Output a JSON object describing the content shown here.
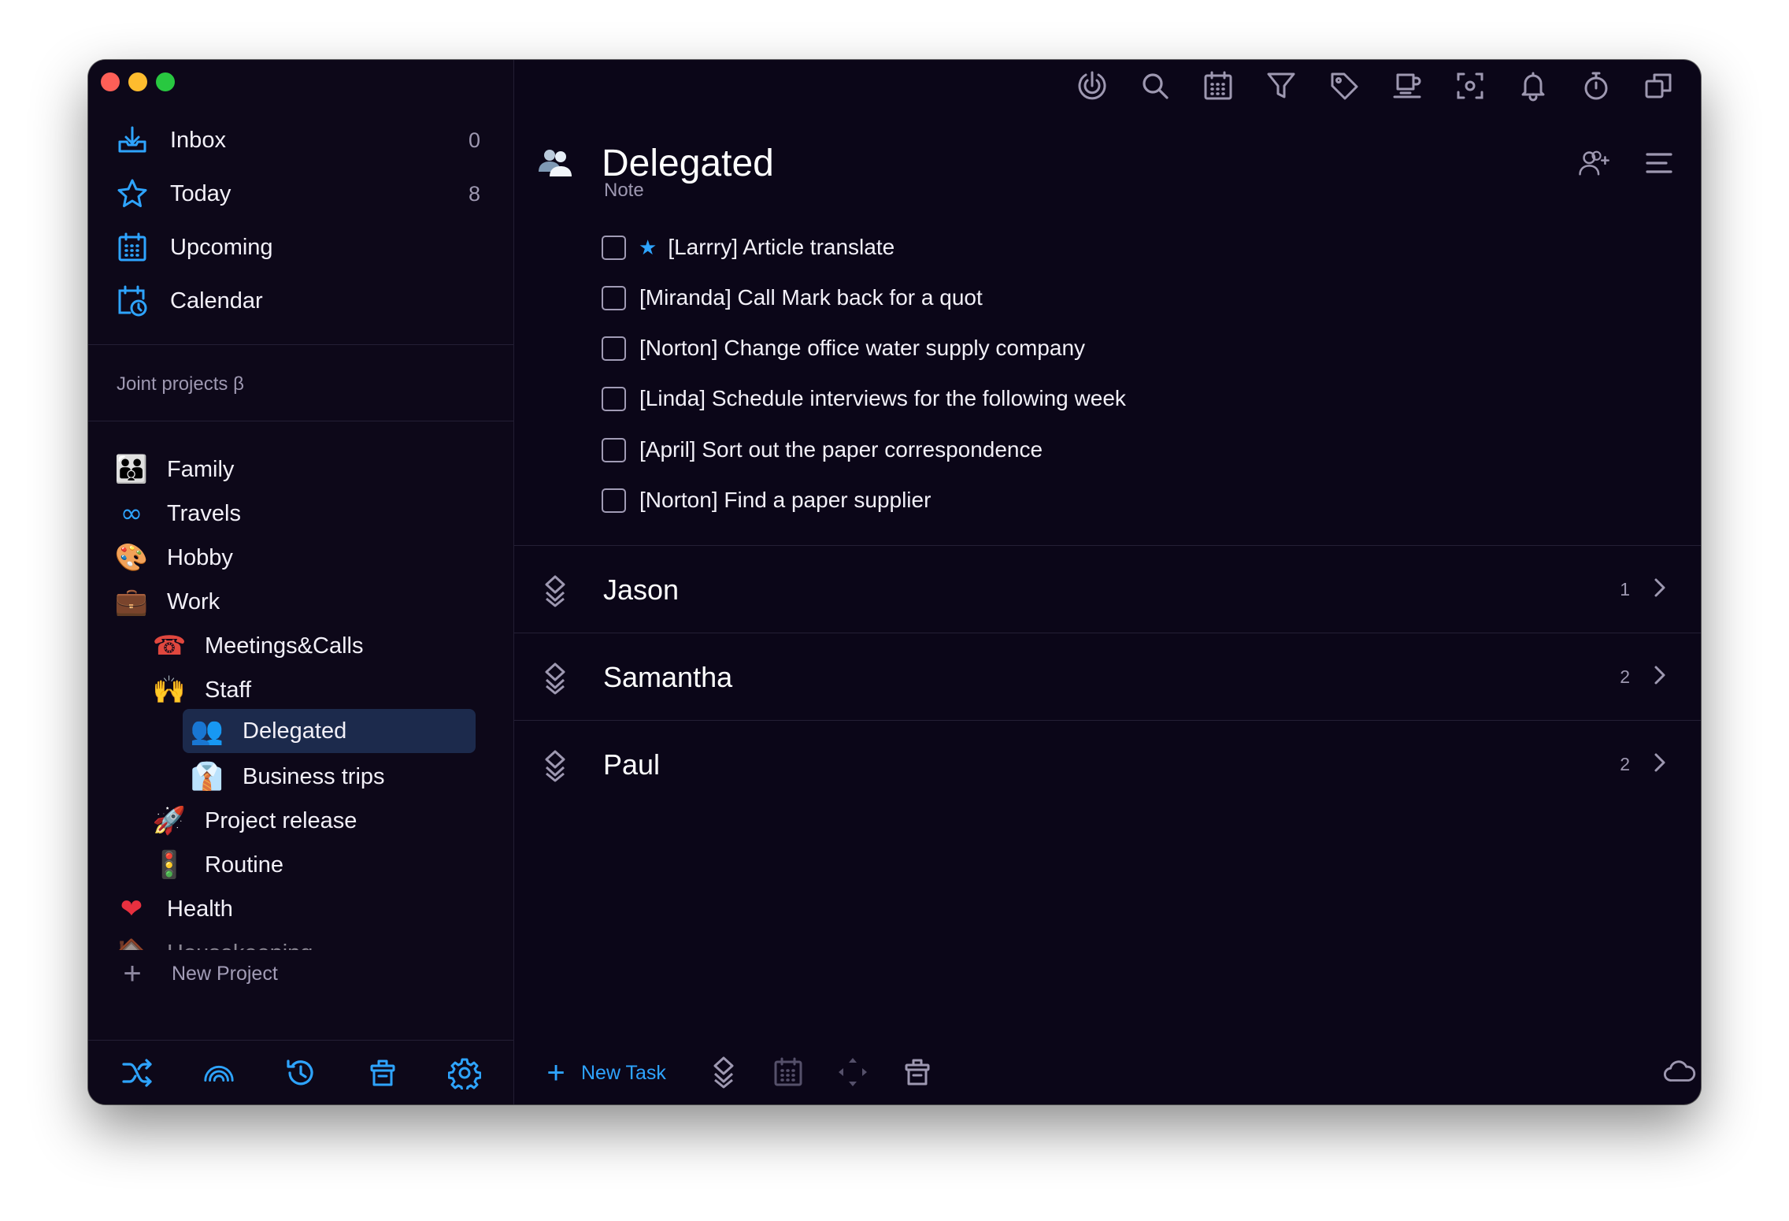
{
  "sidebar": {
    "nav": [
      {
        "label": "Inbox",
        "count": "0",
        "icon": "inbox-tray-icon"
      },
      {
        "label": "Today",
        "count": "8",
        "icon": "star-icon"
      },
      {
        "label": "Upcoming",
        "count": "",
        "icon": "calendar-grid-icon"
      },
      {
        "label": "Calendar",
        "count": "",
        "icon": "calendar-clock-icon"
      }
    ],
    "section_title": "Joint projects β",
    "projects": [
      {
        "label": "Family",
        "emoji": "👪"
      },
      {
        "label": "Travels",
        "emoji": "∞"
      },
      {
        "label": "Hobby",
        "emoji": "🎨"
      },
      {
        "label": "Work",
        "emoji": "💼"
      },
      {
        "label": "Meetings&Calls",
        "emoji": "☎"
      },
      {
        "label": "Staff",
        "emoji": "🙌"
      },
      {
        "label": "Delegated",
        "emoji": "👥"
      },
      {
        "label": "Business trips",
        "emoji": "👔"
      },
      {
        "label": "Project release",
        "emoji": "🚀"
      },
      {
        "label": "Routine",
        "emoji": "🚦"
      },
      {
        "label": "Health",
        "emoji": "❤"
      },
      {
        "label": "Housekeeping",
        "emoji": "🏠"
      }
    ],
    "new_project": "New Project"
  },
  "main": {
    "title": "Delegated",
    "note": "Note",
    "tasks": [
      {
        "text": "[Larrry] Article translate",
        "starred": true
      },
      {
        "text": "[Miranda] Call Mark back for a quot",
        "starred": false
      },
      {
        "text": "[Norton] Change office water supply company",
        "starred": false
      },
      {
        "text": "[Linda] Schedule interviews for the following week",
        "starred": false
      },
      {
        "text": "[April] Sort out the paper correspondence",
        "starred": false
      },
      {
        "text": "[Norton] Find a paper supplier",
        "starred": false
      }
    ],
    "groups": [
      {
        "name": "Jason",
        "count": "1"
      },
      {
        "name": "Samantha",
        "count": "2"
      },
      {
        "name": "Paul",
        "count": "2"
      }
    ],
    "new_task": "New Task"
  },
  "colors": {
    "accent": "#2ea4ff",
    "background": "#0b0618",
    "selected": "#1c2a4c",
    "muted": "#9e98b1"
  }
}
